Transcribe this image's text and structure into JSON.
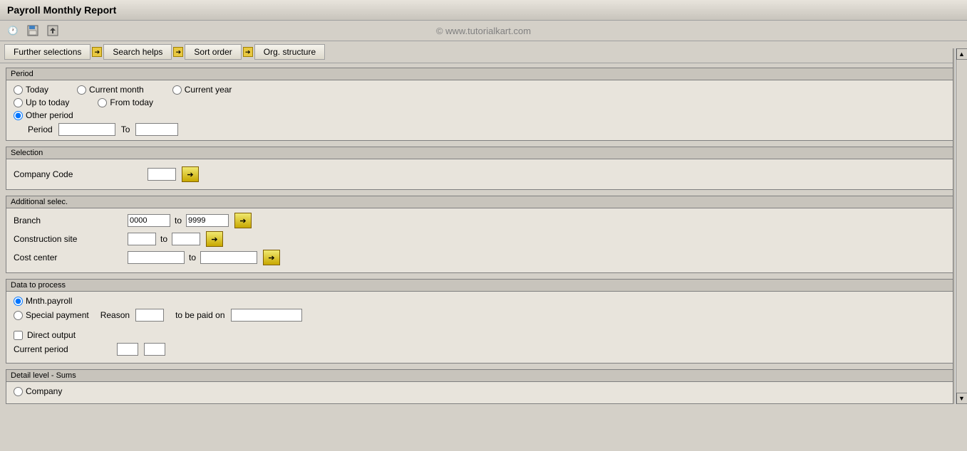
{
  "title": "Payroll Monthly Report",
  "watermark": "© www.tutorialkart.com",
  "toolbar_icons": [
    "clock-icon",
    "save-icon",
    "export-icon"
  ],
  "tabs": [
    {
      "label": "Further selections",
      "has_arrow": true
    },
    {
      "label": "Search helps",
      "has_arrow": true
    },
    {
      "label": "Sort order",
      "has_arrow": true
    },
    {
      "label": "Org. structure",
      "has_arrow": true
    }
  ],
  "period_section": {
    "title": "Period",
    "radio_options": [
      {
        "label": "Today",
        "name": "period",
        "value": "today",
        "checked": false
      },
      {
        "label": "Current month",
        "name": "period",
        "value": "current_month",
        "checked": false
      },
      {
        "label": "Current year",
        "name": "period",
        "value": "current_year",
        "checked": false
      },
      {
        "label": "Up to today",
        "name": "period",
        "value": "up_to_today",
        "checked": false
      },
      {
        "label": "From today",
        "name": "period",
        "value": "from_today",
        "checked": false
      },
      {
        "label": "Other period",
        "name": "period",
        "value": "other_period",
        "checked": true
      }
    ],
    "period_label": "Period",
    "to_label": "To",
    "period_value": "",
    "to_value": ""
  },
  "selection_section": {
    "title": "Selection",
    "company_code_label": "Company Code",
    "company_code_value": ""
  },
  "additional_section": {
    "title": "Additional selec.",
    "rows": [
      {
        "label": "Branch",
        "from_value": "0000",
        "to_value": "9999"
      },
      {
        "label": "Construction site",
        "from_value": "",
        "to_value": ""
      },
      {
        "label": "Cost center",
        "from_value": "",
        "to_value": ""
      }
    ],
    "to_label": "to"
  },
  "data_process_section": {
    "title": "Data to process",
    "radio_options": [
      {
        "label": "Mnth.payroll",
        "value": "mnth_payroll",
        "checked": true
      },
      {
        "label": "Special payment",
        "value": "special_payment",
        "checked": false
      }
    ],
    "reason_label": "Reason",
    "reason_value": "",
    "to_be_paid_label": "to be paid on",
    "to_be_paid_value": "",
    "direct_output_label": "Direct output",
    "current_period_label": "Current period",
    "current_period_value1": "",
    "current_period_value2": ""
  },
  "detail_section": {
    "title": "Detail level - Sums",
    "radio_options": [
      {
        "label": "Company",
        "value": "company",
        "checked": false
      }
    ]
  },
  "scrollbar": {
    "up_label": "▲",
    "down_label": "▼"
  }
}
